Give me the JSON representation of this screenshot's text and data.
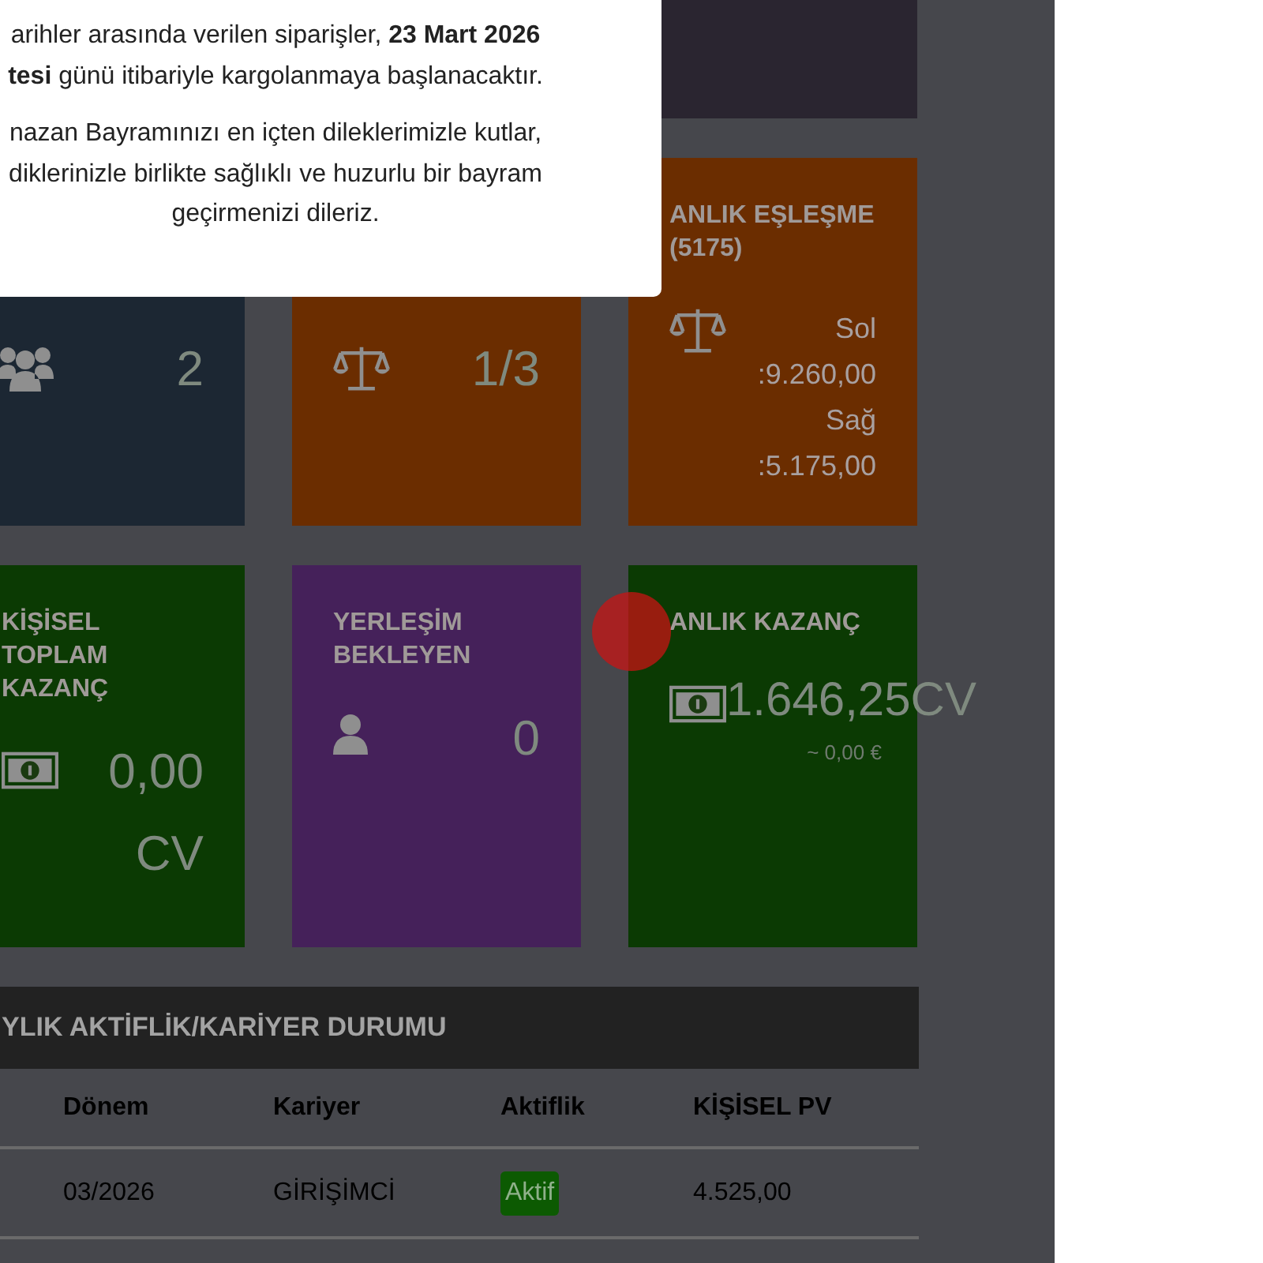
{
  "modal": {
    "paragraphs": [
      {
        "lines": [
          "arihler arasında verilen siparişler, **23 Mart 2026**",
          "**tesi** günü itibariyle kargolanmaya başlanacaktır."
        ]
      },
      {
        "lines": [
          "nazan Bayramınızı en içten dileklerimizle kutlar,",
          "diklerinizle birlikte sağlıklı ve huzurlu bir bayram",
          "geçirmenizi dileriz."
        ]
      }
    ]
  },
  "card_rows": [
    [
      {
        "color": "#1c2733",
        "values": [
          "2"
        ],
        "kind": "members"
      },
      {
        "color": "#6b2d00",
        "values": [
          "1/3"
        ],
        "kind": "balance"
      },
      {
        "color": "#6b2d00",
        "title": "ANLIK EŞLEŞME (5175)",
        "values": [
          "Sol :9.260,00",
          "Sağ :5.175,00"
        ],
        "kind": "balance"
      }
    ],
    [
      {
        "color": "#0b3a03",
        "title": "KİŞİSEL TOPLAM KAZANÇ",
        "values": [
          "0,00 CV"
        ],
        "kind": "earning"
      },
      {
        "color": "#45215a",
        "title": "YERLEŞİM BEKLEYEN",
        "values": [
          "0"
        ],
        "kind": "person"
      },
      {
        "color": "#0b3a03",
        "title": "ANLIK KAZANÇ",
        "values": [
          "1.646,25CV"
        ],
        "note": "~ 0,00 €",
        "kind": "earning"
      }
    ]
  ],
  "table": {
    "title": "YLIK AKTİFLİK/KARİYER DURUMU",
    "columns": [
      "Dönem",
      "Kariyer",
      "Aktiflik",
      "KİŞİSEL PV"
    ],
    "rows": [
      {
        "period": "03/2026",
        "career": "GİRİŞİMCİ",
        "status": {
          "label": "Aktif",
          "color": "#0c5a02"
        },
        "pv": "4.525,00"
      }
    ]
  }
}
